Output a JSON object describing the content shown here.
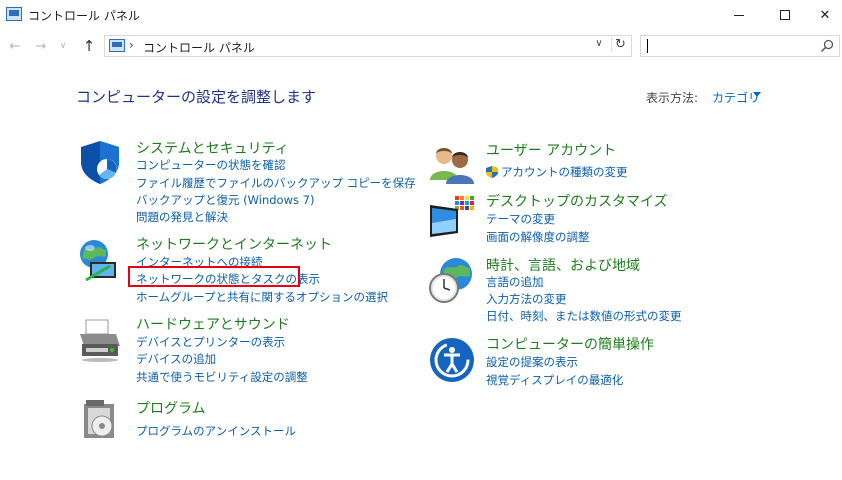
{
  "window": {
    "title": "コントロール パネル",
    "minimize_symbol": "—",
    "close_symbol": "✕"
  },
  "nav": {
    "back": "←",
    "forward": "→",
    "history": "∨",
    "up": "↑",
    "breadcrumb_sep": "›",
    "address": "コントロール パネル",
    "address_dropdown": "∨",
    "refresh": "↻",
    "search_value": ""
  },
  "page": {
    "title": "コンピューターの設定を調整します",
    "view_label": "表示方法:",
    "view_value": "カテゴリ"
  },
  "categories": {
    "system": {
      "icon": "shield-icon",
      "title": "システムとセキュリティ",
      "links": [
        "コンピューターの状態を確認",
        "ファイル履歴でファイルのバックアップ コピーを保存",
        "バックアップと復元 (Windows 7)",
        "問題の発見と解決"
      ]
    },
    "network": {
      "icon": "network-globe-icon",
      "title": "ネットワークとインターネット",
      "links": [
        "インターネットへの接続",
        "ネットワークの状態とタスクの表示",
        "ホームグループと共有に関するオプションの選択"
      ]
    },
    "hardware": {
      "icon": "printer-icon",
      "title": "ハードウェアとサウンド",
      "links": [
        "デバイスとプリンターの表示",
        "デバイスの追加",
        "共通で使うモビリティ設定の調整"
      ]
    },
    "programs": {
      "icon": "programs-icon",
      "title": "プログラム",
      "links": [
        "プログラムのアンインストール"
      ]
    },
    "users": {
      "icon": "users-icon",
      "title": "ユーザー アカウント",
      "links": [
        "アカウントの種類の変更"
      ]
    },
    "appearance": {
      "icon": "monitor-icon",
      "title": "デスクトップのカスタマイズ",
      "links": [
        "テーマの変更",
        "画面の解像度の調整"
      ]
    },
    "clock": {
      "icon": "clock-globe-icon",
      "title": "時計、言語、および地域",
      "links": [
        "言語の追加",
        "入力方法の変更",
        "日付、時刻、または数値の形式の変更"
      ]
    },
    "ease": {
      "icon": "ease-of-access-icon",
      "title": "コンピューターの簡単操作",
      "links": [
        "設定の提案の表示",
        "視覚ディスプレイの最適化"
      ]
    }
  },
  "colors": {
    "category_title": "#1d7d1d",
    "link": "#0b5ea8",
    "page_title": "#1e3287",
    "highlight_box": "#e60012"
  }
}
